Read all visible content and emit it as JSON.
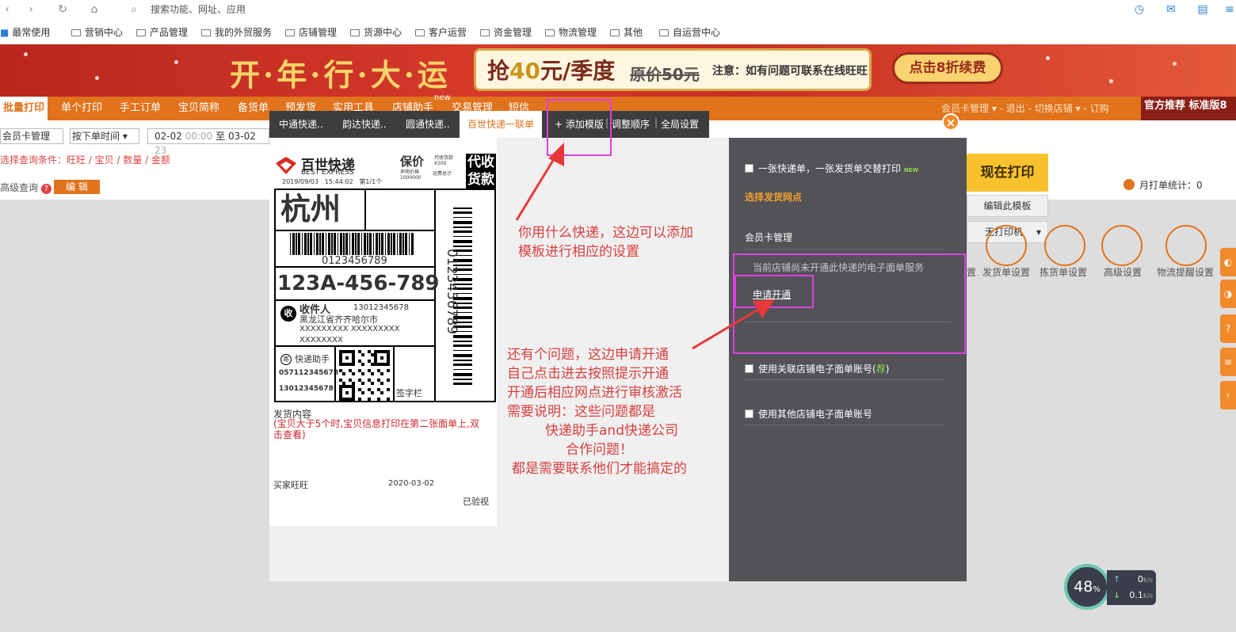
{
  "browser": {
    "address_placeholder": "搜索功能、网址、应用"
  },
  "bookmarks": [
    "最常使用",
    "营销中心",
    "产品管理",
    "我的外贸服务",
    "店铺管理",
    "货源中心",
    "客户运营",
    "资金管理",
    "物流管理",
    "其他",
    "自运营中心"
  ],
  "banner": {
    "title": "开·年·行·大·运",
    "price_prefix": "抢",
    "price_num": "40",
    "price_suffix": "元/季度",
    "orig_price": "原价50元",
    "note": "注意：如有问题可联系在线旺旺",
    "renew_button": "点击8折续费"
  },
  "main_tabs": [
    "批量打印",
    "单个打印",
    "手工订单",
    "宝贝简称",
    "备货单",
    "预发货",
    "实用工具",
    "店铺助手",
    "交易管理",
    "短信"
  ],
  "nav_new_badge": "new",
  "nav_right": "会员卡管理 ▾ - 退出 - 切换店铺 ▾ - 订购",
  "edition": "官方推荐 标准版8",
  "filters": {
    "shop": "会员卡管理",
    "time_type": "按下单时间",
    "date_range_start": "02-02",
    "date_start_time": "00:00",
    "date_sep": "至",
    "date_range_end": "03-02",
    "date_end_time": "23",
    "condition_line": "选择查询条件：旺旺 / 宝贝 / 数量 / 金额",
    "advanced": "高级查询",
    "help": "?",
    "edit_button": "编 辑"
  },
  "dialog": {
    "tabs": [
      "中通快递..",
      "韵达快递..",
      "圆通快递..",
      "百世快递一联单"
    ],
    "add_template": "+ 添加模版",
    "reorder": "调整顺序",
    "global_settings": "全局设置",
    "close": "×"
  },
  "label": {
    "brand_cn": "百世快递",
    "brand_en": "BEST EXPRESS",
    "insured": "保价",
    "insured_small_1": "代收货款",
    "insured_small_2": "¥200",
    "insured_small_3": "声明价格",
    "insured_small_4": "1000000",
    "insured_small_5": "运费总计",
    "cod_1": "代收",
    "cod_2": "货款",
    "date": "2019/09/03",
    "time": "15:44:02",
    "page": "第1/1个",
    "city": "杭州",
    "barcode_num": "0123456789",
    "vertical_num": "0123456789",
    "sort_code": "123A-456-789",
    "recv_mark": "收",
    "recv_label": "收件人",
    "recv_phone": "13012345678",
    "recv_addr": "黑龙江省齐齐哈尔市",
    "recv_x1": "XXXXXXXXX XXXXXXXXX",
    "recv_x2": "XXXXXXXX",
    "sender_mark": "寄",
    "sender_name": "快递助手",
    "sender_phone1": "057112345678",
    "sender_phone2": "13012345678",
    "sign": "签字栏",
    "content_title": "发货内容",
    "content_note": "(宝贝大于5个时,宝贝信息打印在第二张面单上,双击查看)",
    "buyer": "买家旺旺",
    "buyer_date": "2020-03-02",
    "checked": "已验视"
  },
  "side": {
    "alt_print": "一张快递单，一张发货单交替打印",
    "new_tag": "NEW",
    "choose_branch": "选择发货网点",
    "shop": "会员卡管理",
    "not_open": "当前店铺尚未开通此快递的电子面单服务",
    "apply": "申请开通",
    "linked": "使用关联店铺电子面单账号(",
    "linked_rec": "荐",
    "linked_end": ")",
    "other": "使用其他店铺电子面单账号"
  },
  "actions": {
    "print_now": "现在打印",
    "edit_template": "编辑此模板",
    "no_printer": "无打印机",
    "monthly_stats": "月打单统计：0"
  },
  "settings_icons": [
    "置",
    "发货单设置",
    "拣货单设置",
    "高级设置",
    "物流提醒设置"
  ],
  "annotations": {
    "a1_line1": "你用什么快递，这边可以添加",
    "a1_line2": "模板进行相应的设置",
    "a2_line1": "还有个问题，这边申请开通",
    "a2_line2": "自己点击进去按照提示开通",
    "a2_line3": "开通后相应网点进行审核激活",
    "a2_line4": "需要说明：这些问题都是",
    "a2_line5": "快递助手and快递公司",
    "a2_line6": "合作问题！",
    "a2_line7": "都是需要联系他们才能搞定的"
  },
  "speed": {
    "percent": "48",
    "percent_sign": "%",
    "up": "0",
    "down": "0.1",
    "unit": "K/s"
  },
  "colors": {
    "accent": "#e0731c",
    "annotation": "#d94040",
    "highlight_box": "#e040e0",
    "side_panel": "#525257"
  }
}
